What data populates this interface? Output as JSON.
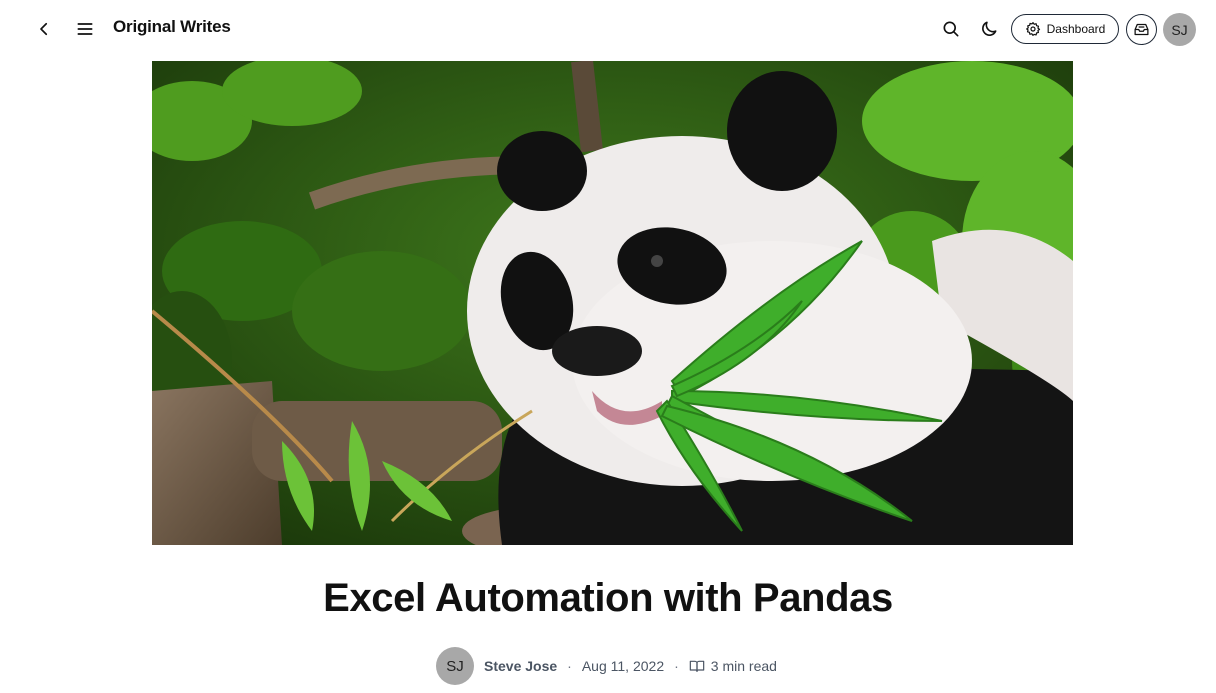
{
  "header": {
    "back_icon": "chevron-left-icon",
    "menu_icon": "hamburger-menu-icon",
    "site_title": "Original Writes",
    "search_icon": "search-icon",
    "theme_icon": "moon-icon",
    "dashboard_label": "Dashboard",
    "dashboard_icon": "gear-icon",
    "inbox_icon": "inbox-icon",
    "avatar_initials": "SJ"
  },
  "cover": {
    "subject": "panda-eating-bamboo-photo"
  },
  "article": {
    "title": "Excel Automation with Pandas",
    "author_initials": "SJ",
    "author": "Steve Jose",
    "separator": "·",
    "date": "Aug 11, 2022",
    "read_icon": "book-open-icon",
    "read_time": "3 min read"
  },
  "colors": {
    "text": "#111111",
    "muted": "#4b5563",
    "avatar_bg": "#a8a8a8",
    "border": "#1f2937"
  }
}
